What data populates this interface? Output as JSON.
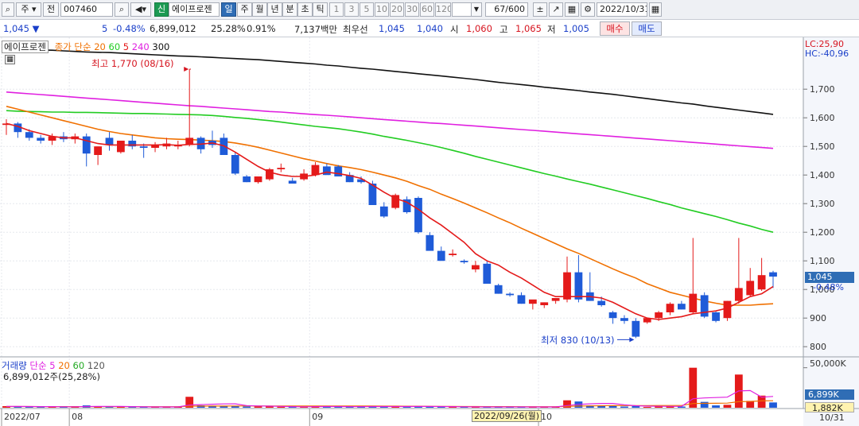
{
  "toolbar": {
    "type_label": "주",
    "jeon_label": "전",
    "code": "007460",
    "sin_label": "신",
    "stock_name": "에이프로젠",
    "periods": [
      "일",
      "주",
      "월",
      "년",
      "분",
      "초",
      "틱"
    ],
    "period_selected": "일",
    "intervals": [
      "1",
      "3",
      "5",
      "10",
      "20",
      "30",
      "60",
      "120"
    ],
    "count_value": "67/600",
    "date_value": "2022/10/31"
  },
  "quote": {
    "price": "1,045",
    "change": "5",
    "change_pct": "-0.48%",
    "volume": "6,899,012",
    "turnover_pct": "25.28%",
    "pct2": "0.91%",
    "amount": "7,137백만",
    "label_choiusun": "최우선",
    "bid1": "1,045",
    "bid2": "1,040",
    "label_open": "시",
    "open": "1,060",
    "label_high": "고",
    "high": "1,065",
    "label_low": "저",
    "low": "1,005",
    "buy_label": "매수",
    "sell_label": "매도"
  },
  "price_legend": {
    "stock": "에이프로젠",
    "ma_label": "종가 단순",
    "ma_periods": [
      "20",
      "60",
      "5",
      "240",
      "300"
    ],
    "ma_colors": [
      "#f07000",
      "#22cc22",
      "#e41a1a",
      "#e020e0",
      "#111111"
    ]
  },
  "volume_legend": {
    "label": "거래량",
    "ma_label": "단순",
    "periods": [
      "5",
      "20",
      "60",
      "120"
    ],
    "colors": [
      "#e020e0",
      "#f07000",
      "#22aa22",
      "#555555"
    ],
    "value": "6,899,012주(25,28%)"
  },
  "annotations": {
    "high_note": "최고 1,770 (08/16)",
    "low_note": "최저 830 (10/13)",
    "lc": "LC:25,90",
    "hc": "HC:-40,96",
    "current_price": "1,045",
    "current_pct": "-0.48%",
    "vol_current": "6,899K",
    "vol_ma": "1,882K",
    "crosshair_date": "2022/09/26(월)",
    "last_date": "10/31"
  },
  "chart_data": {
    "type": "candlestick",
    "ylim": [
      770,
      1870
    ],
    "yticks": [
      "1,700",
      "1,600",
      "1,500",
      "1,400",
      "1,300",
      "1,200",
      "1,100",
      "1,000",
      "900",
      "800"
    ],
    "ytick_values": [
      1700,
      1600,
      1500,
      1400,
      1300,
      1200,
      1100,
      1000,
      900,
      800
    ],
    "xlabels": [
      "2022/07",
      "08",
      "09",
      "10"
    ],
    "xlabel_index": [
      0,
      6,
      27,
      47
    ],
    "candles": [
      [
        1575,
        1595,
        1540,
        1580
      ],
      [
        1580,
        1585,
        1530,
        1550
      ],
      [
        1550,
        1560,
        1520,
        1530
      ],
      [
        1530,
        1540,
        1510,
        1520
      ],
      [
        1520,
        1545,
        1505,
        1535
      ],
      [
        1535,
        1550,
        1515,
        1525
      ],
      [
        1525,
        1545,
        1510,
        1535
      ],
      [
        1535,
        1545,
        1430,
        1475
      ],
      [
        1470,
        1500,
        1435,
        1500
      ],
      [
        1530,
        1550,
        1485,
        1505
      ],
      [
        1480,
        1520,
        1475,
        1520
      ],
      [
        1520,
        1540,
        1490,
        1500
      ],
      [
        1500,
        1510,
        1460,
        1495
      ],
      [
        1495,
        1515,
        1480,
        1505
      ],
      [
        1500,
        1530,
        1490,
        1510
      ],
      [
        1500,
        1520,
        1490,
        1505
      ],
      [
        1505,
        1770,
        1500,
        1530
      ],
      [
        1530,
        1535,
        1475,
        1490
      ],
      [
        1520,
        1555,
        1495,
        1505
      ],
      [
        1530,
        1545,
        1470,
        1470
      ],
      [
        1470,
        1480,
        1400,
        1405
      ],
      [
        1395,
        1400,
        1375,
        1375
      ],
      [
        1375,
        1395,
        1370,
        1395
      ],
      [
        1385,
        1425,
        1380,
        1420
      ],
      [
        1420,
        1440,
        1410,
        1425
      ],
      [
        1380,
        1390,
        1370,
        1370
      ],
      [
        1385,
        1420,
        1380,
        1405
      ],
      [
        1400,
        1445,
        1395,
        1435
      ],
      [
        1430,
        1440,
        1400,
        1400
      ],
      [
        1430,
        1435,
        1400,
        1395
      ],
      [
        1400,
        1410,
        1375,
        1375
      ],
      [
        1385,
        1395,
        1370,
        1375
      ],
      [
        1370,
        1380,
        1295,
        1295
      ],
      [
        1290,
        1305,
        1250,
        1255
      ],
      [
        1285,
        1335,
        1280,
        1330
      ],
      [
        1315,
        1325,
        1265,
        1270
      ],
      [
        1320,
        1325,
        1195,
        1200
      ],
      [
        1190,
        1200,
        1140,
        1135
      ],
      [
        1135,
        1150,
        1100,
        1100
      ],
      [
        1120,
        1140,
        1115,
        1125
      ],
      [
        1100,
        1105,
        1090,
        1095
      ],
      [
        1070,
        1100,
        1060,
        1085
      ],
      [
        1090,
        1100,
        1020,
        1020
      ],
      [
        1015,
        1020,
        985,
        985
      ],
      [
        985,
        990,
        975,
        980
      ],
      [
        980,
        990,
        950,
        950
      ],
      [
        950,
        960,
        930,
        965
      ],
      [
        945,
        955,
        935,
        955
      ],
      [
        960,
        965,
        950,
        970
      ],
      [
        965,
        1115,
        955,
        1060
      ],
      [
        1060,
        1120,
        955,
        965
      ],
      [
        990,
        1060,
        960,
        960
      ],
      [
        960,
        975,
        940,
        945
      ],
      [
        920,
        925,
        880,
        900
      ],
      [
        900,
        910,
        880,
        890
      ],
      [
        890,
        900,
        830,
        835
      ],
      [
        885,
        900,
        880,
        900
      ],
      [
        900,
        925,
        890,
        920
      ],
      [
        920,
        955,
        910,
        950
      ],
      [
        950,
        960,
        930,
        930
      ],
      [
        920,
        1180,
        915,
        985
      ],
      [
        980,
        990,
        900,
        905
      ],
      [
        920,
        925,
        885,
        890
      ],
      [
        900,
        960,
        890,
        960
      ],
      [
        960,
        1180,
        950,
        1005
      ],
      [
        980,
        1075,
        975,
        1030
      ],
      [
        1000,
        1110,
        995,
        1050
      ],
      [
        1060,
        1065,
        1005,
        1045
      ]
    ],
    "volumes": [
      80,
      60,
      50,
      40,
      50,
      40,
      40,
      120,
      60,
      60,
      40,
      40,
      40,
      40,
      40,
      40,
      560,
      120,
      100,
      90,
      90,
      60,
      60,
      60,
      50,
      40,
      40,
      80,
      60,
      60,
      40,
      40,
      80,
      60,
      60,
      60,
      80,
      60,
      50,
      40,
      40,
      40,
      40,
      40,
      40,
      40,
      40,
      40,
      40,
      380,
      320,
      120,
      90,
      100,
      60,
      80,
      40,
      60,
      80,
      60,
      2050,
      300,
      120,
      150,
      1700,
      350,
      620,
      270
    ],
    "vol_ylim": [
      0,
      2200
    ],
    "vol_ytick": "50,000K",
    "ma5": [
      1580,
      1570,
      1555,
      1545,
      1535,
      1530,
      1530,
      1520,
      1510,
      1505,
      1505,
      1505,
      1505,
      1505,
      1506,
      1504,
      1507,
      1508,
      1512,
      1502,
      1480,
      1455,
      1430,
      1410,
      1400,
      1395,
      1395,
      1400,
      1410,
      1405,
      1398,
      1388,
      1365,
      1340,
      1318,
      1305,
      1280,
      1250,
      1225,
      1195,
      1165,
      1125,
      1100,
      1085,
      1060,
      1040,
      1015,
      990,
      975,
      975,
      975,
      975,
      970,
      955,
      935,
      915,
      900,
      895,
      900,
      905,
      915,
      920,
      925,
      935,
      955,
      975,
      985,
      1010
    ],
    "ma20": [
      1640,
      1630,
      1620,
      1610,
      1600,
      1590,
      1580,
      1570,
      1560,
      1552,
      1545,
      1540,
      1535,
      1530,
      1527,
      1525,
      1524,
      1522,
      1520,
      1517,
      1512,
      1505,
      1497,
      1487,
      1477,
      1467,
      1457,
      1449,
      1440,
      1432,
      1426,
      1419,
      1410,
      1400,
      1390,
      1378,
      1363,
      1350,
      1333,
      1318,
      1302,
      1285,
      1268,
      1250,
      1233,
      1214,
      1196,
      1178,
      1160,
      1142,
      1126,
      1108,
      1090,
      1072,
      1055,
      1040,
      1020,
      1005,
      990,
      980,
      970,
      960,
      952,
      945,
      945,
      945,
      948,
      950
    ],
    "ma60": [
      1625,
      1623,
      1622,
      1621,
      1620,
      1620,
      1619,
      1619,
      1618,
      1617,
      1616,
      1615,
      1615,
      1614,
      1613,
      1612,
      1611,
      1610,
      1608,
      1605,
      1601,
      1598,
      1594,
      1590,
      1585,
      1580,
      1575,
      1570,
      1566,
      1562,
      1556,
      1550,
      1543,
      1535,
      1528,
      1521,
      1513,
      1505,
      1496,
      1486,
      1476,
      1465,
      1455,
      1445,
      1435,
      1425,
      1415,
      1405,
      1396,
      1386,
      1377,
      1368,
      1358,
      1348,
      1338,
      1328,
      1318,
      1307,
      1297,
      1285,
      1275,
      1265,
      1255,
      1244,
      1232,
      1222,
      1210,
      1200
    ],
    "ma240": [
      1690,
      1687,
      1684,
      1681,
      1678,
      1675,
      1672,
      1669,
      1666,
      1663,
      1660,
      1657,
      1654,
      1651,
      1648,
      1645,
      1642,
      1640,
      1637,
      1634,
      1631,
      1628,
      1625,
      1622,
      1620,
      1617,
      1614,
      1611,
      1609,
      1606,
      1603,
      1600,
      1597,
      1594,
      1591,
      1588,
      1585,
      1582,
      1580,
      1577,
      1574,
      1571,
      1568,
      1565,
      1562,
      1559,
      1556,
      1553,
      1550,
      1547,
      1544,
      1541,
      1538,
      1535,
      1532,
      1529,
      1526,
      1523,
      1520,
      1517,
      1514,
      1511,
      1508,
      1505,
      1502,
      1499,
      1496,
      1493
    ],
    "ma300": [
      1840,
      1839,
      1838,
      1837,
      1836,
      1834,
      1832,
      1830,
      1829,
      1828,
      1826,
      1824,
      1822,
      1820,
      1818,
      1816,
      1815,
      1813,
      1811,
      1809,
      1807,
      1805,
      1803,
      1800,
      1797,
      1794,
      1791,
      1788,
      1784,
      1781,
      1777,
      1773,
      1770,
      1766,
      1762,
      1758,
      1754,
      1750,
      1746,
      1742,
      1738,
      1734,
      1729,
      1724,
      1720,
      1716,
      1712,
      1707,
      1703,
      1699,
      1695,
      1690,
      1686,
      1682,
      1677,
      1672,
      1667,
      1662,
      1657,
      1652,
      1648,
      1642,
      1637,
      1632,
      1627,
      1622,
      1617,
      1612
    ],
    "vol_ma5": [
      70,
      65,
      60,
      55,
      55,
      50,
      48,
      60,
      65,
      70,
      65,
      55,
      45,
      42,
      40,
      40,
      140,
      160,
      180,
      195,
      200,
      110,
      90,
      80,
      70,
      55,
      50,
      55,
      60,
      60,
      55,
      55,
      60,
      60,
      60,
      60,
      65,
      65,
      60,
      55,
      50,
      45,
      42,
      42,
      40,
      40,
      40,
      40,
      40,
      110,
      170,
      200,
      220,
      220,
      150,
      100,
      80,
      75,
      70,
      70,
      460,
      500,
      520,
      540,
      860,
      880,
      540,
      580
    ],
    "vol_ma20": [
      60,
      60,
      60,
      58,
      58,
      56,
      55,
      55,
      55,
      55,
      55,
      55,
      54,
      54,
      54,
      54,
      80,
      82,
      84,
      86,
      88,
      90,
      90,
      90,
      90,
      88,
      88,
      90,
      90,
      90,
      90,
      88,
      85,
      82,
      80,
      78,
      76,
      74,
      70,
      66,
      62,
      60,
      58,
      56,
      55,
      54,
      54,
      53,
      52,
      70,
      85,
      95,
      100,
      105,
      110,
      112,
      112,
      113,
      114,
      115,
      215,
      225,
      230,
      235,
      310,
      320,
      350,
      360
    ]
  }
}
